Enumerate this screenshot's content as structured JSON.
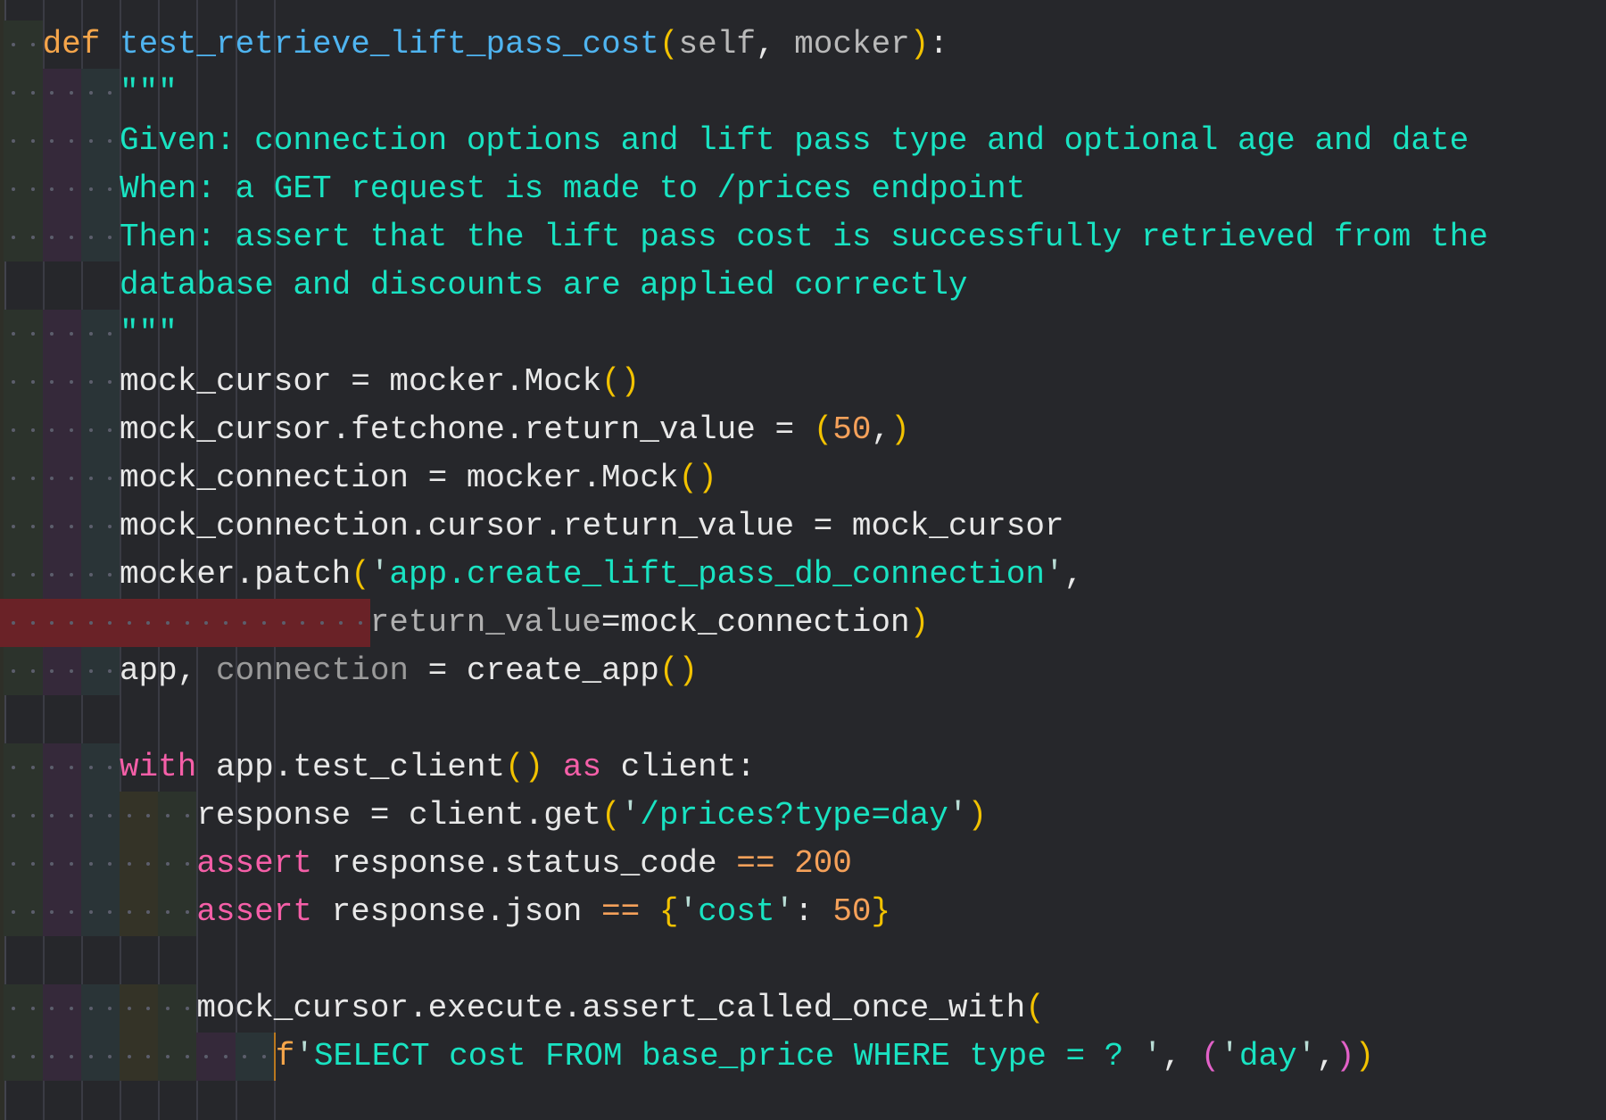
{
  "editor": {
    "language": "python",
    "colors": {
      "background": "#26272b",
      "error_highlight": "#6a2227",
      "indent_bands": [
        "#2c332c",
        "#35293a",
        "#2a3437",
        "#343327"
      ]
    },
    "lines": [
      {
        "indent": 2,
        "tokens": [
          [
            "t-kw-def",
            "def"
          ],
          [
            "t-plain",
            " "
          ],
          [
            "t-fn",
            "test_retrieve_lift_pass_cost"
          ],
          [
            "t-paren1",
            "("
          ],
          [
            "t-param",
            "self"
          ],
          [
            "t-plain",
            ", "
          ],
          [
            "t-param",
            "mocker"
          ],
          [
            "t-paren1",
            ")"
          ],
          [
            "t-plain",
            ":"
          ]
        ]
      },
      {
        "indent": 6,
        "tokens": [
          [
            "t-doc",
            "\"\"\""
          ]
        ]
      },
      {
        "indent": 6,
        "tokens": [
          [
            "t-doc",
            "Given: connection options and lift pass type and optional age and date"
          ]
        ]
      },
      {
        "indent": 6,
        "tokens": [
          [
            "t-doc",
            "When: a GET request is made to /prices endpoint"
          ]
        ]
      },
      {
        "indent": 6,
        "tokens": [
          [
            "t-doc",
            "Then: assert that the lift pass cost is successfully retrieved from the"
          ]
        ]
      },
      {
        "indent": 6,
        "wrap": true,
        "tokens": [
          [
            "t-doc",
            "database and discounts are applied correctly"
          ]
        ]
      },
      {
        "indent": 6,
        "tokens": [
          [
            "t-doc",
            "\"\"\""
          ]
        ]
      },
      {
        "indent": 6,
        "tokens": [
          [
            "t-plain",
            "mock_cursor = mocker.Mock"
          ],
          [
            "t-paren1",
            "()"
          ]
        ]
      },
      {
        "indent": 6,
        "tokens": [
          [
            "t-plain",
            "mock_cursor.fetchone.return_value = "
          ],
          [
            "t-paren1",
            "("
          ],
          [
            "t-num",
            "50"
          ],
          [
            "t-plain",
            ","
          ],
          [
            "t-paren1",
            ")"
          ]
        ]
      },
      {
        "indent": 6,
        "tokens": [
          [
            "t-plain",
            "mock_connection = mocker.Mock"
          ],
          [
            "t-paren1",
            "()"
          ]
        ]
      },
      {
        "indent": 6,
        "tokens": [
          [
            "t-plain",
            "mock_connection.cursor.return_value = mock_cursor"
          ]
        ]
      },
      {
        "indent": 6,
        "tokens": [
          [
            "t-plain",
            "mocker.patch"
          ],
          [
            "t-paren1",
            "("
          ],
          [
            "t-quote",
            "'"
          ],
          [
            "t-str",
            "app.create_lift_pass_db_connection"
          ],
          [
            "t-quote",
            "'"
          ],
          [
            "t-plain",
            ","
          ]
        ]
      },
      {
        "indent": 19,
        "error": true,
        "tokens": [
          [
            "t-kwarg",
            "return_value"
          ],
          [
            "t-plain",
            "=mock_connection"
          ],
          [
            "t-paren1",
            ")"
          ]
        ]
      },
      {
        "indent": 6,
        "tokens": [
          [
            "t-plain",
            "app, "
          ],
          [
            "t-dim",
            "connection"
          ],
          [
            "t-plain",
            " = create_app"
          ],
          [
            "t-paren1",
            "()"
          ]
        ]
      },
      {
        "indent": 0,
        "blank": true,
        "tokens": []
      },
      {
        "indent": 6,
        "tokens": [
          [
            "t-kw",
            "with"
          ],
          [
            "t-plain",
            " app.test_client"
          ],
          [
            "t-paren1",
            "()"
          ],
          [
            "t-plain",
            " "
          ],
          [
            "t-kw",
            "as"
          ],
          [
            "t-plain",
            " client:"
          ]
        ]
      },
      {
        "indent": 10,
        "tokens": [
          [
            "t-plain",
            "response = client.get"
          ],
          [
            "t-paren1",
            "("
          ],
          [
            "t-quote",
            "'"
          ],
          [
            "t-str",
            "/prices?type=day"
          ],
          [
            "t-quote",
            "'"
          ],
          [
            "t-paren1",
            ")"
          ]
        ]
      },
      {
        "indent": 10,
        "tokens": [
          [
            "t-kw",
            "assert"
          ],
          [
            "t-plain",
            " response.status_code "
          ],
          [
            "t-op",
            "=="
          ],
          [
            "t-plain",
            " "
          ],
          [
            "t-num",
            "200"
          ]
        ]
      },
      {
        "indent": 10,
        "tokens": [
          [
            "t-kw",
            "assert"
          ],
          [
            "t-plain",
            " response.json "
          ],
          [
            "t-op",
            "=="
          ],
          [
            "t-plain",
            " "
          ],
          [
            "t-paren1",
            "{"
          ],
          [
            "t-quote",
            "'"
          ],
          [
            "t-str",
            "cost"
          ],
          [
            "t-quote",
            "'"
          ],
          [
            "t-plain",
            ": "
          ],
          [
            "t-num",
            "50"
          ],
          [
            "t-paren1",
            "}"
          ]
        ]
      },
      {
        "indent": 0,
        "blank": true,
        "tokens": []
      },
      {
        "indent": 10,
        "tokens": [
          [
            "t-plain",
            "mock_cursor.execute.assert_called_once_with"
          ],
          [
            "t-paren1",
            "("
          ]
        ]
      },
      {
        "indent": 14,
        "caret": true,
        "tokens": [
          [
            "t-fprefix",
            "f"
          ],
          [
            "t-quote",
            "'"
          ],
          [
            "t-str",
            "SELECT cost FROM base_price WHERE type = ? "
          ],
          [
            "t-quote",
            "'"
          ],
          [
            "t-plain",
            ", "
          ],
          [
            "t-paren2",
            "("
          ],
          [
            "t-quote",
            "'"
          ],
          [
            "t-str",
            "day"
          ],
          [
            "t-quote",
            "'"
          ],
          [
            "t-plain",
            ","
          ],
          [
            "t-paren2",
            ")"
          ],
          [
            "t-paren1",
            ")"
          ]
        ]
      }
    ]
  }
}
